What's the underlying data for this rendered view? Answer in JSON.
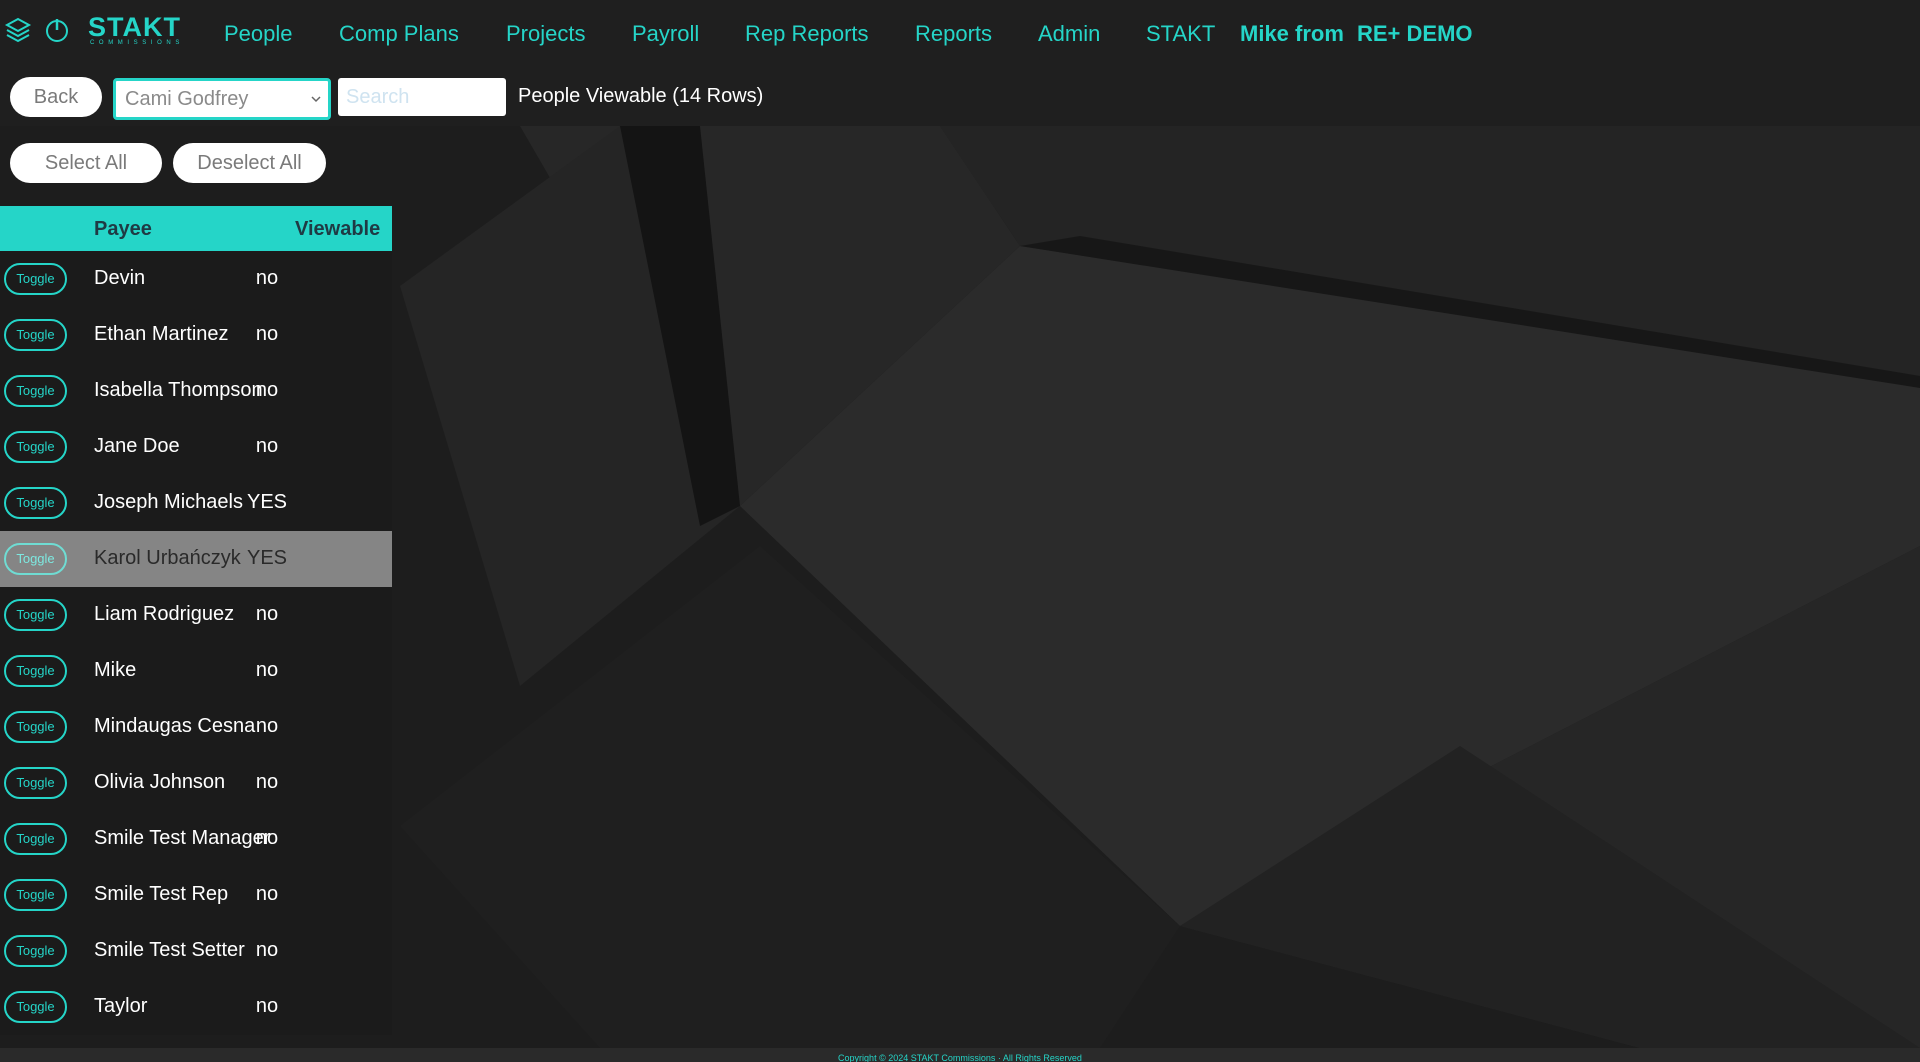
{
  "nav": {
    "logo_text": "STAKT",
    "logo_sub": "COMMISSIONS",
    "items": [
      "People",
      "Comp Plans",
      "Projects",
      "Payroll",
      "Rep Reports",
      "Reports",
      "Admin",
      "STAKT"
    ],
    "user_prefix": "Mike from",
    "user_company": "RE+ DEMO"
  },
  "toolbar": {
    "back_label": "Back",
    "selected_person": "Cami Godfrey",
    "search_placeholder": "Search",
    "caption": "People Viewable  (14 Rows)",
    "select_all_label": "Select All",
    "deselect_all_label": "Deselect All"
  },
  "table": {
    "headers": {
      "payee": "Payee",
      "viewable": "Viewable"
    },
    "toggle_label": "Toggle",
    "rows": [
      {
        "payee": "Devin",
        "viewable": "no"
      },
      {
        "payee": "Ethan Martinez",
        "viewable": "no"
      },
      {
        "payee": "Isabella Thompson",
        "viewable": "no"
      },
      {
        "payee": "Jane Doe",
        "viewable": "no"
      },
      {
        "payee": "Joseph Michaels",
        "viewable": "YES"
      },
      {
        "payee": "Karol Urbańczyk",
        "viewable": "YES"
      },
      {
        "payee": "Liam Rodriguez",
        "viewable": "no"
      },
      {
        "payee": "Mike",
        "viewable": "no"
      },
      {
        "payee": "Mindaugas Cesna",
        "viewable": "no"
      },
      {
        "payee": "Olivia Johnson",
        "viewable": "no"
      },
      {
        "payee": "Smile Test Manager",
        "viewable": "no"
      },
      {
        "payee": "Smile Test Rep",
        "viewable": "no"
      },
      {
        "payee": "Smile Test Setter",
        "viewable": "no"
      },
      {
        "payee": "Taylor",
        "viewable": "no"
      }
    ],
    "highlighted_row": 5
  },
  "footer": {
    "text": "Copyright © 2024 STAKT Commissions · All Rights Reserved"
  },
  "colors": {
    "accent": "#25d5c8",
    "background": "#1c1c1c",
    "highlight": "#858585"
  }
}
